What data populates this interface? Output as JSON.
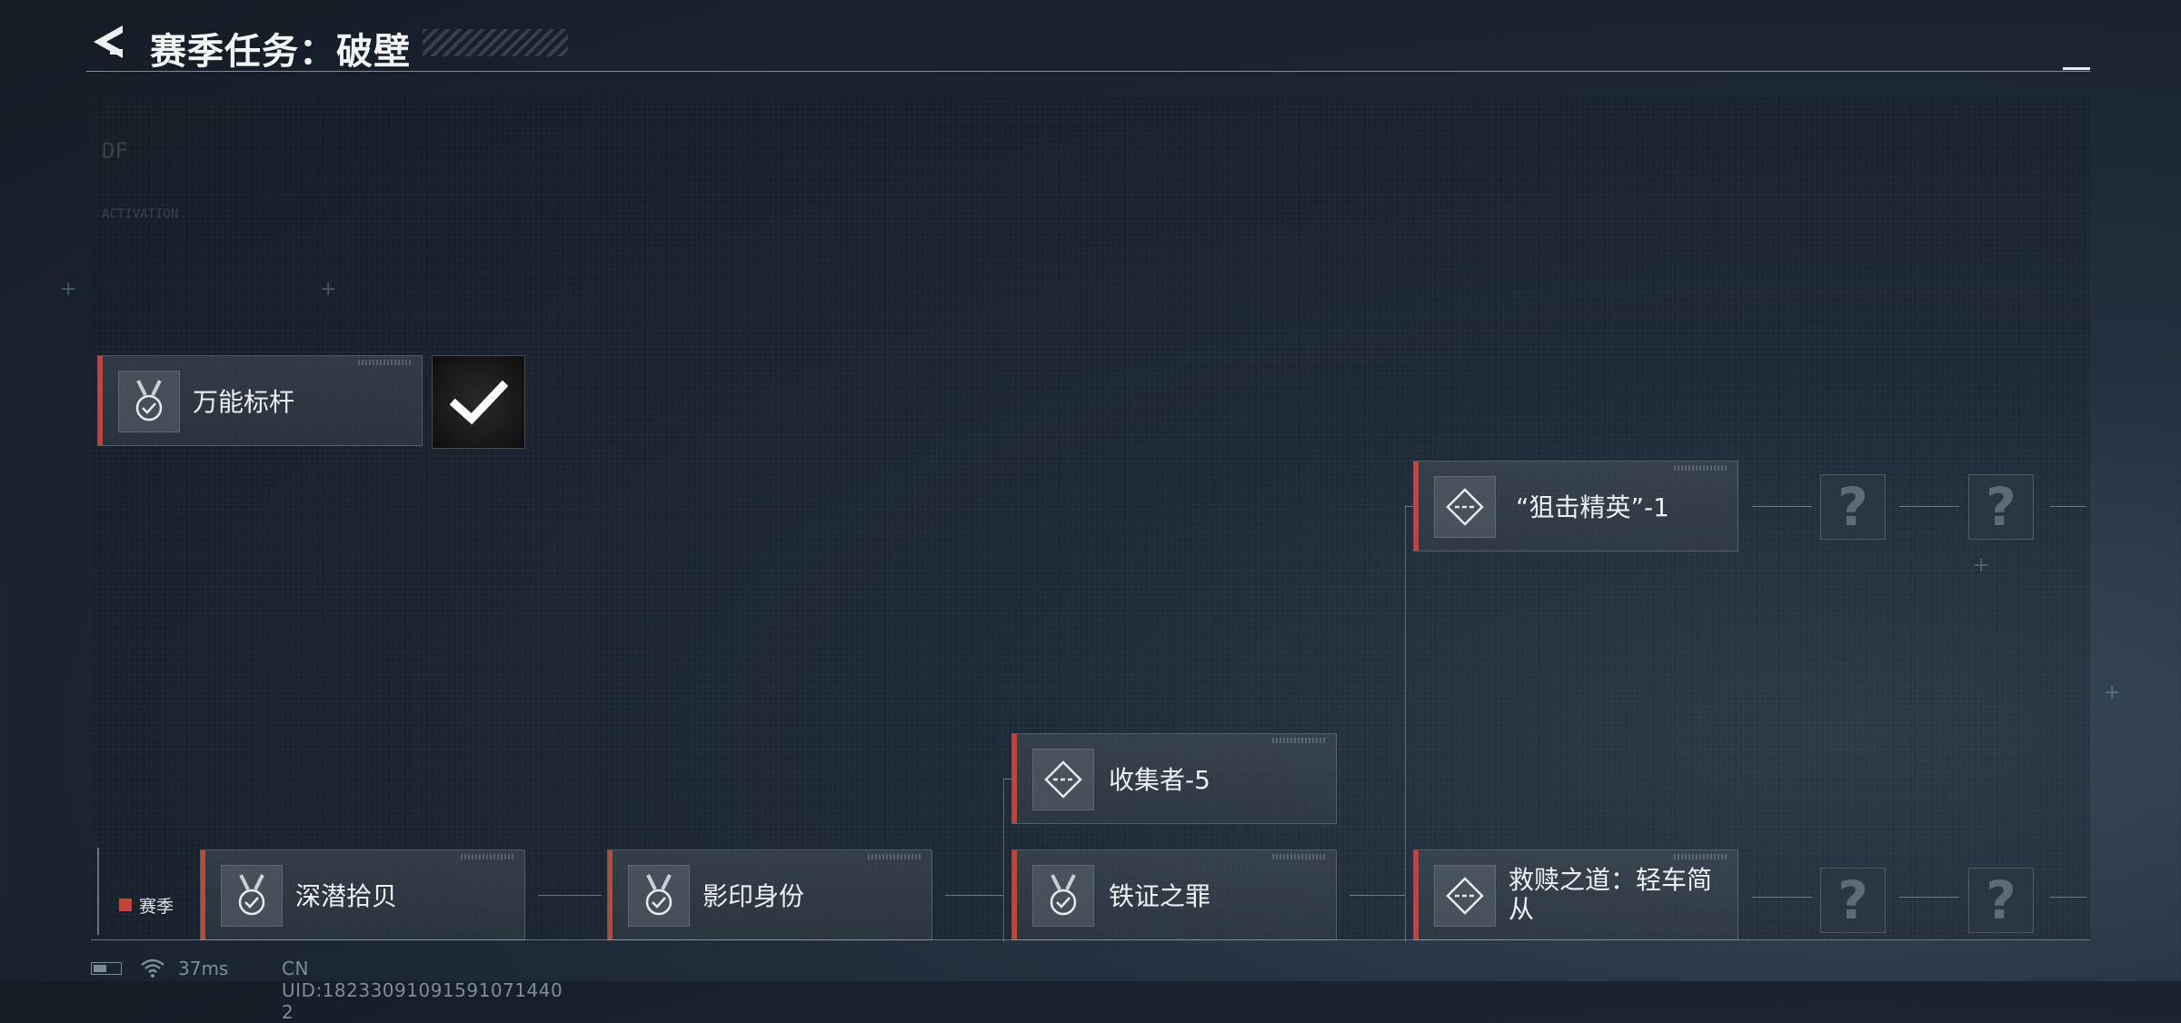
{
  "header": {
    "title": "赛季任务：破壁"
  },
  "tasks": [
    {
      "label": "万能标杆",
      "icon": "medal-check-icon",
      "status": "completed"
    },
    {
      "label": "“狙击精英”-1",
      "icon": "diamond-dash-icon"
    },
    {
      "label": "收集者-5",
      "icon": "diamond-dash-icon"
    },
    {
      "label": "深潜拾贝",
      "icon": "medal-check-icon"
    },
    {
      "label": "影印身份",
      "icon": "medal-check-icon"
    },
    {
      "label": "铁证之罪",
      "icon": "medal-check-icon"
    },
    {
      "label": "救赎之道：轻车简从",
      "icon": "diamond-dash-icon"
    }
  ],
  "locked_symbol": "?",
  "season_tab": {
    "label": "赛季"
  },
  "status_bar": {
    "ping": "37ms",
    "uid": "CN UID:18233091091591071440​2"
  },
  "background_text": {
    "line1": "DF",
    "line2": "ACTIVATION"
  },
  "colors": {
    "accent_red": "#c2453a",
    "background": "#1a2430"
  }
}
